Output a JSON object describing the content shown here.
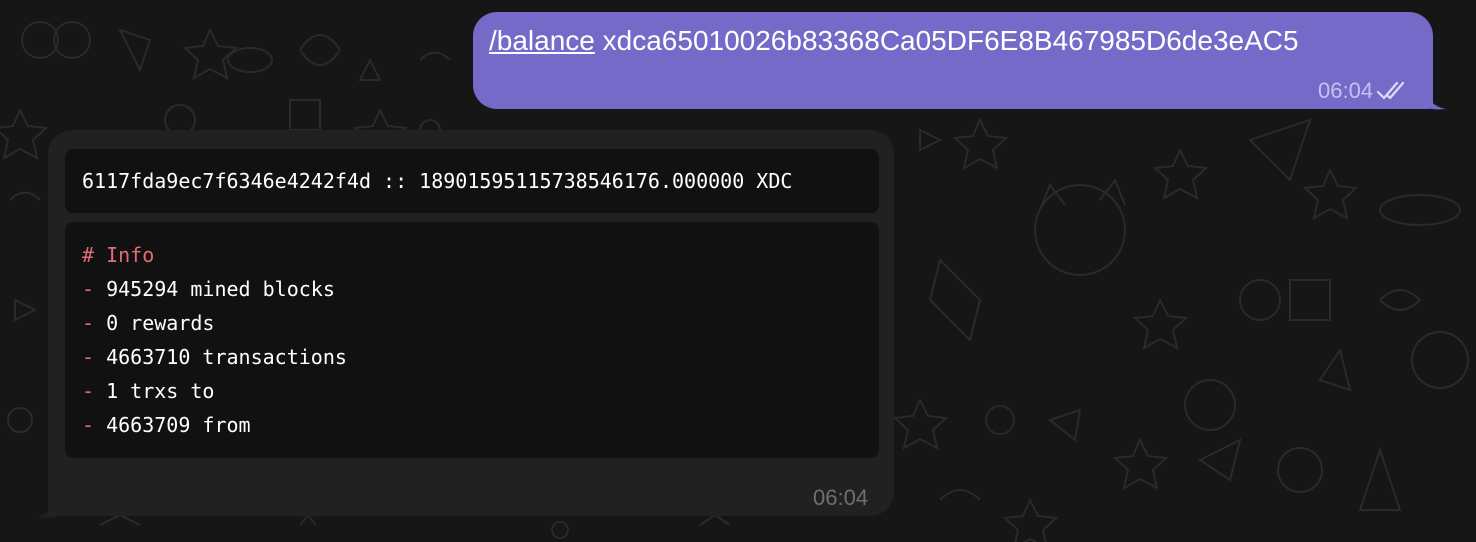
{
  "outgoing": {
    "command": "/balance",
    "argument": "xdca65010026b83368Ca05DF6E8B467985D6de3eAC5",
    "time": "06:04",
    "status_icon": "double-check-icon"
  },
  "incoming": {
    "balance_line": "6117fda9ec7f6346e4242f4d :: 189015951157385461​76.000000 XDC",
    "info": {
      "heading": "# Info",
      "bullet": "-",
      "items": [
        "945294 mined blocks",
        "0 rewards",
        "4663710 transactions",
        "1 trxs to",
        "4663709 from"
      ]
    },
    "time": "06:04"
  },
  "colors": {
    "outgoing_bubble": "#766ac8",
    "incoming_bubble": "#212121",
    "code_background": "#111111",
    "highlight": "#e06c75",
    "background": "#161616"
  }
}
